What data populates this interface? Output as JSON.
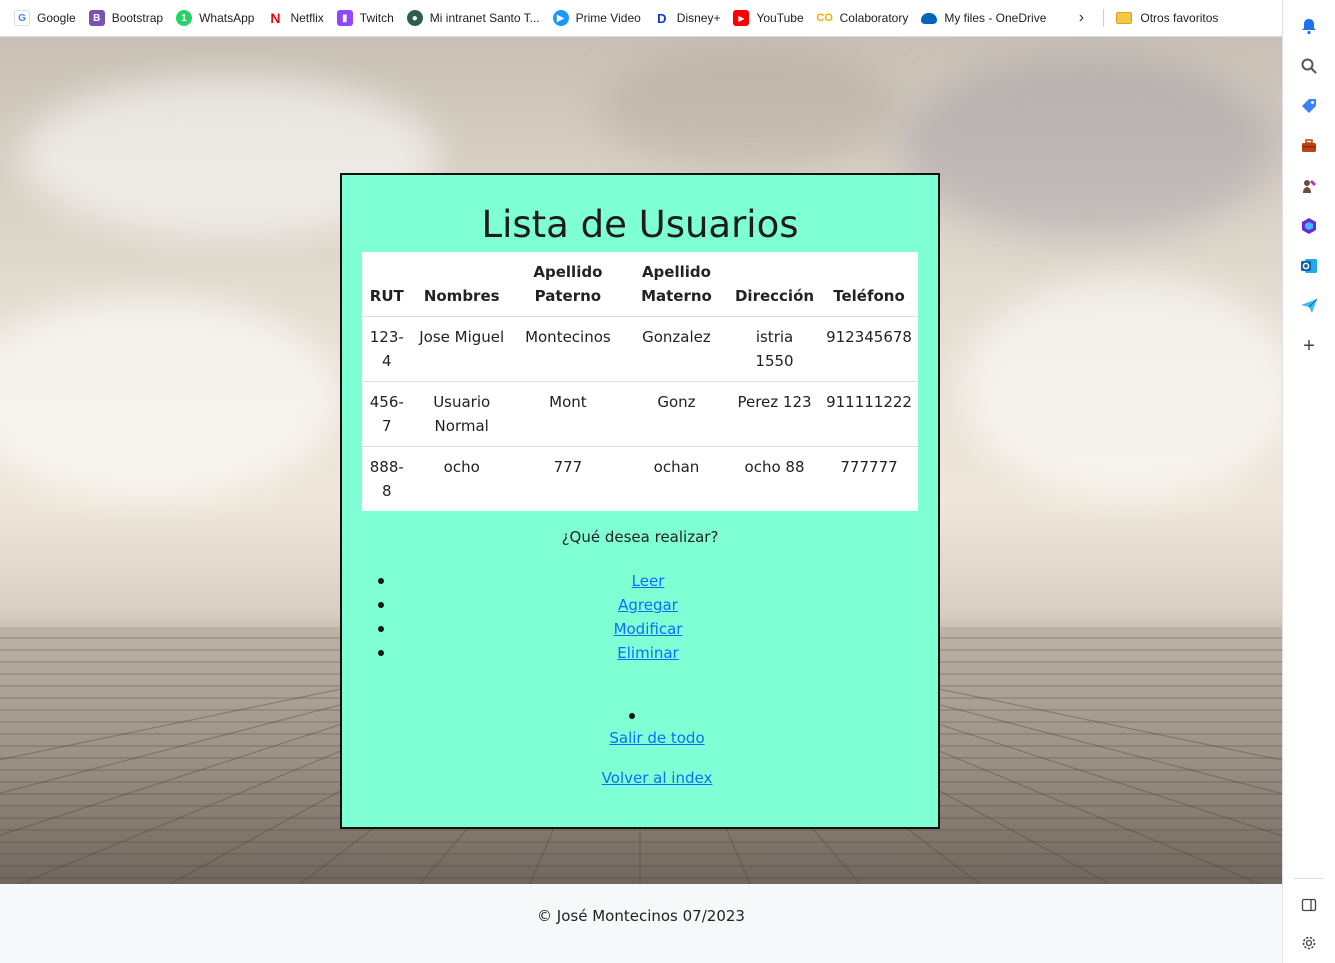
{
  "bookmarks": {
    "items": [
      {
        "label": "Google",
        "icon": "google-icon",
        "color": "#4285f4"
      },
      {
        "label": "Bootstrap",
        "icon": "bootstrap-icon",
        "color": "#7952b3"
      },
      {
        "label": "WhatsApp",
        "icon": "whatsapp-icon",
        "color": "#25d366"
      },
      {
        "label": "Netflix",
        "icon": "netflix-icon",
        "color": "#e50914"
      },
      {
        "label": "Twitch",
        "icon": "twitch-icon",
        "color": "#9146ff"
      },
      {
        "label": "Mi intranet Santo T...",
        "icon": "intranet-icon",
        "color": "#2e5e4e"
      },
      {
        "label": "Prime Video",
        "icon": "prime-video-icon",
        "color": "#1a98ff"
      },
      {
        "label": "Disney+",
        "icon": "disney-icon",
        "color": "#113ccf"
      },
      {
        "label": "YouTube",
        "icon": "youtube-icon",
        "color": "#ff0000"
      },
      {
        "label": "Colaboratory",
        "icon": "colab-icon",
        "color": "#f9ab00"
      },
      {
        "label": "My files - OneDrive",
        "icon": "onedrive-icon",
        "color": "#0364b8"
      }
    ],
    "more": "›",
    "other_favorites": "Otros favoritos"
  },
  "card": {
    "title": "Lista de Usuarios",
    "table": {
      "headers": [
        "RUT",
        "Nombres",
        "Apellido Paterno",
        "Apellido Materno",
        "Dirección",
        "Teléfono"
      ],
      "rows": [
        [
          "123-4",
          "Jose Miguel",
          "Montecinos",
          "Gonzalez",
          "istria 1550",
          "912345678"
        ],
        [
          "456-7",
          "Usuario Normal",
          "Mont",
          "Gonz",
          "Perez 123",
          "911111222"
        ],
        [
          "888-8",
          "ocho",
          "777",
          "ochan",
          "ocho 88",
          "777777"
        ]
      ]
    },
    "question": "¿Qué desea realizar?",
    "actions": [
      "Leer",
      "Agregar",
      "Modificar",
      "Eliminar"
    ],
    "exit": "Salir de todo",
    "back": "Volver al index"
  },
  "footer": {
    "text": "© José Montecinos 07/2023"
  },
  "colors": {
    "card_bg": "#7fffd4",
    "link": "#0d6efd"
  }
}
